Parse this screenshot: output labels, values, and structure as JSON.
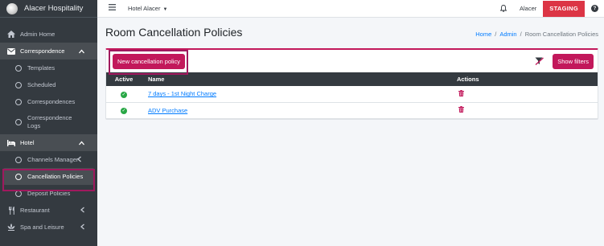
{
  "brand": {
    "name": "Alacer Hospitality"
  },
  "sidebar": {
    "admin_home": "Admin Home",
    "correspondence": "Correspondence",
    "correspondence_items": [
      "Templates",
      "Scheduled",
      "Correspondences",
      "Correspondence Logs"
    ],
    "hotel": "Hotel",
    "hotel_items": [
      "Channels Manager",
      "Cancellation Policies",
      "Deposit Policies"
    ],
    "restaurant": "Restaurant",
    "spa": "Spa and Leisure"
  },
  "topbar": {
    "hotel_selector": "Hotel Alacer",
    "user": "Alacer",
    "env_badge": "STAGING",
    "help": "?"
  },
  "page": {
    "title": "Room Cancellation Policies",
    "breadcrumb": [
      "Home",
      "/",
      "Admin",
      "/",
      "Room Cancellation Policies"
    ]
  },
  "toolbar": {
    "new_label": "New cancellation policy",
    "filters_label": "Show filters"
  },
  "table": {
    "headers": [
      "Active",
      "Name",
      "Actions"
    ],
    "rows": [
      {
        "name": "7 days - 1st Night Charge",
        "active": true
      },
      {
        "name": "ADV Purchase",
        "active": true
      }
    ]
  },
  "colors": {
    "accent": "#c2185b",
    "sidebar": "#343a40",
    "staging": "#dc3545",
    "success": "#28a745",
    "link": "#007bff"
  }
}
